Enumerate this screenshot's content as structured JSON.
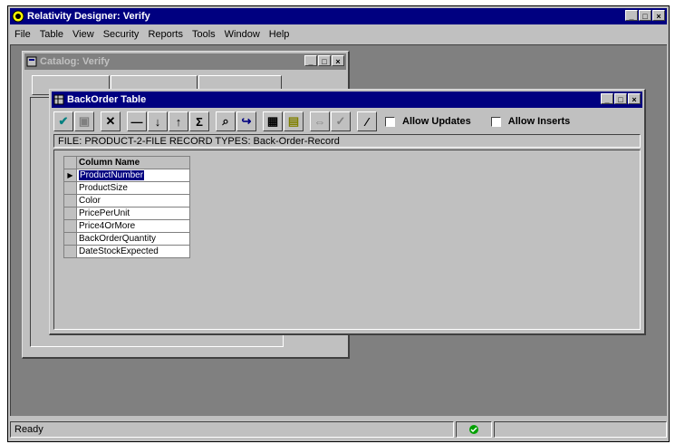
{
  "app": {
    "title": "Relativity Designer: Verify"
  },
  "menu": [
    "File",
    "Table",
    "View",
    "Security",
    "Reports",
    "Tools",
    "Window",
    "Help"
  ],
  "catalog_window": {
    "title": "Catalog: Verify"
  },
  "backorder_window": {
    "title": "BackOrder Table",
    "allow_updates_label": "Allow Updates",
    "allow_inserts_label": "Allow Inserts",
    "info": "FILE: PRODUCT-2-FILE   RECORD TYPES:  Back-Order-Record",
    "grid": {
      "header": "Column Name",
      "rows": [
        "ProductNumber",
        "ProductSize",
        "Color",
        "PricePerUnit",
        "Price4OrMore",
        "BackOrderQuantity",
        "DateStockExpected"
      ],
      "selected_index": 0
    }
  },
  "toolbar_icons": [
    "check-icon",
    "save-icon",
    "delete-icon",
    "minus-icon",
    "sort-down-icon",
    "sort-up-icon",
    "sum-icon",
    "find-icon",
    "redo-icon",
    "grid-icon",
    "table-icon",
    "link-icon",
    "check-ok-icon",
    "wand-icon"
  ],
  "status": {
    "text": "Ready"
  },
  "colors": {
    "title_active": "#000080",
    "title_inactive": "#808080",
    "workspace": "#808080",
    "face": "#c0c0c0"
  }
}
